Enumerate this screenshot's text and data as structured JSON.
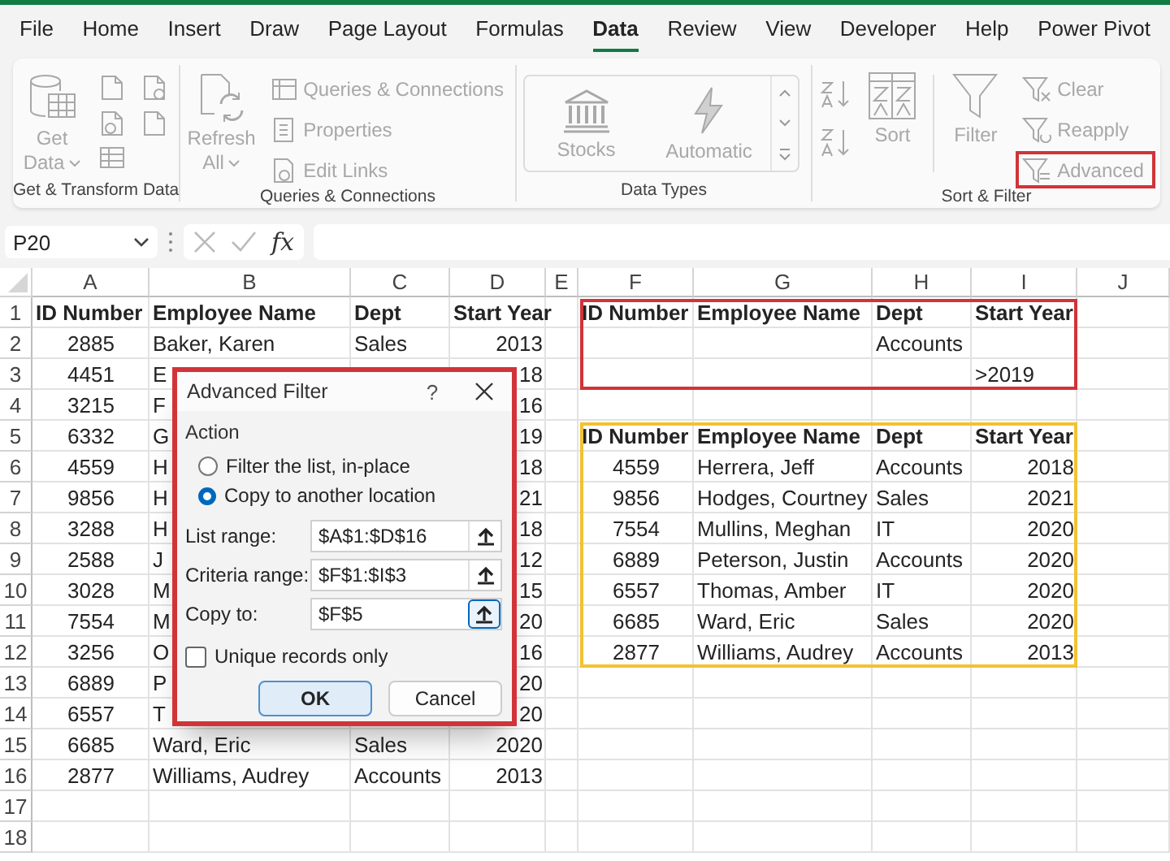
{
  "tabs": [
    {
      "label": "File",
      "selected": false
    },
    {
      "label": "Home",
      "selected": false
    },
    {
      "label": "Insert",
      "selected": false
    },
    {
      "label": "Draw",
      "selected": false
    },
    {
      "label": "Page Layout",
      "selected": false
    },
    {
      "label": "Formulas",
      "selected": false
    },
    {
      "label": "Data",
      "selected": true
    },
    {
      "label": "Review",
      "selected": false
    },
    {
      "label": "View",
      "selected": false
    },
    {
      "label": "Developer",
      "selected": false
    },
    {
      "label": "Help",
      "selected": false
    },
    {
      "label": "Power Pivot",
      "selected": false
    }
  ],
  "ribbon": {
    "get_transform": {
      "label": "Get & Transform Data",
      "get_data": {
        "label": "Get Data",
        "disabled": true
      }
    },
    "queries": {
      "label": "Queries & Connections",
      "refresh_all": {
        "label": "Refresh All",
        "disabled": true
      },
      "commands": [
        {
          "label": "Queries & Connections",
          "disabled": true
        },
        {
          "label": "Properties",
          "disabled": true
        },
        {
          "label": "Edit Links",
          "disabled": true
        }
      ]
    },
    "data_types": {
      "label": "Data Types",
      "types": [
        {
          "label": "Stocks",
          "disabled": true
        },
        {
          "label": "Automatic",
          "disabled": true
        }
      ]
    },
    "sort_filter": {
      "label": "Sort & Filter",
      "sort": {
        "label": "Sort",
        "disabled": true
      },
      "filter": {
        "label": "Filter",
        "disabled": true
      },
      "commands": [
        {
          "label": "Clear",
          "disabled": true,
          "highlighted": false
        },
        {
          "label": "Reapply",
          "disabled": true,
          "highlighted": false
        },
        {
          "label": "Advanced",
          "disabled": true,
          "highlighted": true
        }
      ]
    }
  },
  "formula_bar": {
    "name_box": "P20",
    "insert_function": "fx"
  },
  "sheet": {
    "columns": [
      "A",
      "B",
      "C",
      "D",
      "E",
      "F",
      "G",
      "H",
      "I",
      "J"
    ],
    "row_numbers": [
      "1",
      "2",
      "3",
      "4",
      "5",
      "6",
      "7",
      "8",
      "9",
      "10",
      "11",
      "12",
      "13",
      "14",
      "15",
      "16",
      "17",
      "18"
    ],
    "list": {
      "columns": [
        "ID Number",
        "Employee Name",
        "Dept",
        "Start Year"
      ],
      "rows": [
        {
          "id": "2885",
          "name": "Baker, Karen",
          "dept": "Sales",
          "year": "2013"
        },
        {
          "id": "4451",
          "name": "E",
          "year": "18"
        },
        {
          "id": "3215",
          "name": "F",
          "year": "16"
        },
        {
          "id": "6332",
          "name": "G",
          "year": "19"
        },
        {
          "id": "4559",
          "name": "H",
          "year": "18"
        },
        {
          "id": "9856",
          "name": "H",
          "year": "21"
        },
        {
          "id": "3288",
          "name": "H",
          "year": "18"
        },
        {
          "id": "2588",
          "name": "J",
          "year": "12"
        },
        {
          "id": "3028",
          "name": "M",
          "year": "15"
        },
        {
          "id": "7554",
          "name": "M",
          "year": "20"
        },
        {
          "id": "3256",
          "name": "O",
          "year": "16"
        },
        {
          "id": "6889",
          "name": "P",
          "year": "20"
        },
        {
          "id": "6557",
          "name": "T",
          "year": "20"
        },
        {
          "id": "6685",
          "name": "Ward, Eric",
          "dept": "Sales",
          "year": "2020"
        },
        {
          "id": "2877",
          "name": "Williams, Audrey",
          "dept": "Accounts",
          "year": "2013"
        }
      ]
    },
    "criteria": {
      "highlighted": true,
      "columns": [
        "ID Number",
        "Employee Name",
        "Dept",
        "Start Year"
      ],
      "rows": [
        {
          "dept": "Accounts"
        },
        {
          "year": ">2019"
        }
      ]
    },
    "output": {
      "highlighted": true,
      "columns": [
        "ID Number",
        "Employee Name",
        "Dept",
        "Start Year"
      ],
      "rows": [
        {
          "id": "4559",
          "name": "Herrera, Jeff",
          "dept": "Accounts",
          "year": "2018"
        },
        {
          "id": "9856",
          "name": "Hodges, Courtney",
          "dept": "Sales",
          "year": "2021"
        },
        {
          "id": "7554",
          "name": "Mullins, Meghan",
          "dept": "IT",
          "year": "2020"
        },
        {
          "id": "6889",
          "name": "Peterson, Justin",
          "dept": "Accounts",
          "year": "2020"
        },
        {
          "id": "6557",
          "name": "Thomas, Amber",
          "dept": "IT",
          "year": "2020"
        },
        {
          "id": "6685",
          "name": "Ward, Eric",
          "dept": "Sales",
          "year": "2020"
        },
        {
          "id": "2877",
          "name": "Williams, Audrey",
          "dept": "Accounts",
          "year": "2013"
        }
      ]
    }
  },
  "dialog": {
    "title": "Advanced Filter",
    "help": "?",
    "highlighted": true,
    "action_label": "Action",
    "options": [
      {
        "label": "Filter the list, in-place",
        "selected": false
      },
      {
        "label": "Copy to another location",
        "selected": true
      }
    ],
    "fields": [
      {
        "label": "List range:",
        "value": "$A$1:$D$16",
        "picker_focused": false
      },
      {
        "label": "Criteria range:",
        "value": "$F$1:$I$3",
        "picker_focused": false
      },
      {
        "label": "Copy to:",
        "value": "$F$5",
        "picker_focused": true
      }
    ],
    "unique": {
      "label": "Unique records only",
      "checked": false
    },
    "buttons": [
      {
        "label": "OK",
        "default": true
      },
      {
        "label": "Cancel",
        "default": false
      }
    ]
  }
}
